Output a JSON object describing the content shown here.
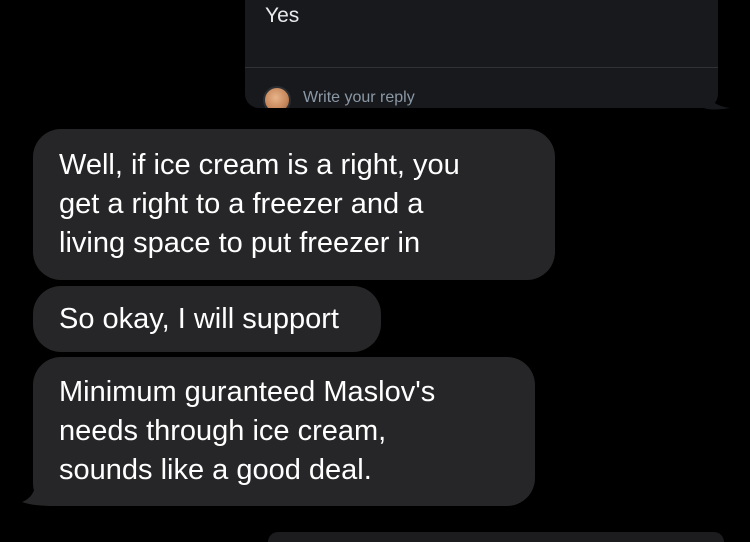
{
  "shared_card": {
    "poll_answer": "Yes",
    "reply_placeholder": "Write your reply",
    "avatar_icon": "user-avatar-photo"
  },
  "messages": [
    {
      "sender": "other",
      "text": "Well, if ice cream is a right, you\nget a right to a freezer and a\nliving space to put freezer in"
    },
    {
      "sender": "other",
      "text": "So okay, I will support"
    },
    {
      "sender": "other",
      "text": "Minimum guranteed Maslov's\nneeds through ice cream,\nsounds like a good deal."
    }
  ],
  "colors": {
    "background": "#000000",
    "received_bubble": "#262628",
    "card_background": "#17191d",
    "text_primary": "#ffffff",
    "text_secondary": "#8b98a5"
  }
}
